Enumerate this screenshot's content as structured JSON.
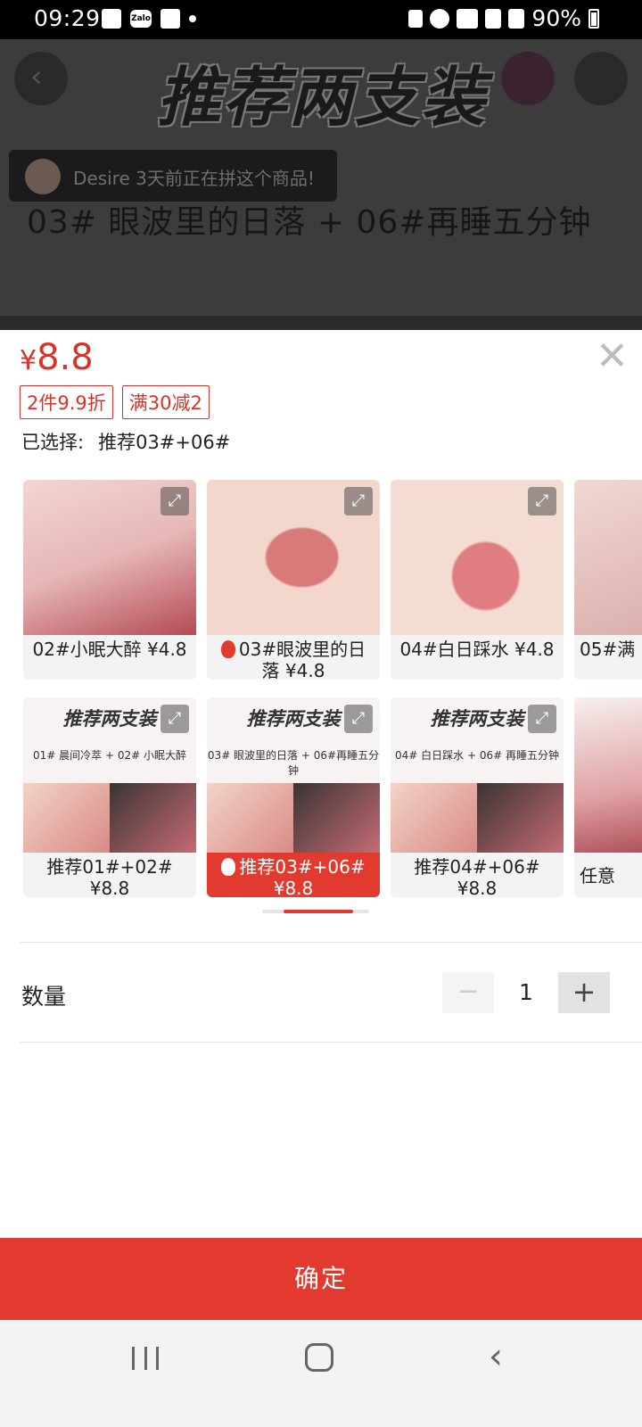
{
  "status_bar": {
    "time": "09:29",
    "battery": "90%"
  },
  "background_page": {
    "headline": "推荐两支装",
    "notice": "Desire 3天前正在拼这个商品!",
    "subtitle": "03# 眼波里的日落 + 06#再睡五分钟"
  },
  "sheet": {
    "price_symbol": "¥",
    "price_value": "8.8",
    "badges": [
      "2件9.9折",
      "满30减2"
    ],
    "selected_label": "已选择:",
    "selected_value": "推荐03#+06#",
    "options_row1": [
      {
        "label": "02#小眠大醉 ¥4.8",
        "hot": false,
        "selected": false
      },
      {
        "label": "03#眼波里的日落 ¥4.8",
        "hot": true,
        "selected": false
      },
      {
        "label": "04#白日踩水 ¥4.8",
        "hot": false,
        "selected": false
      },
      {
        "label": "05#满",
        "hot": false,
        "selected": false
      }
    ],
    "options_row2": [
      {
        "label": "推荐01#+02# ¥8.8",
        "hot": false,
        "selected": false,
        "combo_title": "推荐两支装",
        "combo_sub": "01# 晨间冷萃 + 02# 小眠大醉"
      },
      {
        "label": "推荐03#+06# ¥8.8",
        "hot": true,
        "selected": true,
        "combo_title": "推荐两支装",
        "combo_sub": "03# 眼波里的日落 + 06#再睡五分钟"
      },
      {
        "label": "推荐04#+06# ¥8.8",
        "hot": false,
        "selected": false,
        "combo_title": "推荐两支装",
        "combo_sub": "04# 白日踩水 + 06# 再睡五分钟"
      },
      {
        "label": "任意",
        "hot": false,
        "selected": false
      }
    ],
    "quantity_label": "数量",
    "quantity_value": "1",
    "minus": "−",
    "plus": "+",
    "confirm_label": "确定",
    "close_glyph": "✕"
  },
  "colors": {
    "accent": "#e23a2e",
    "price": "#d8322a"
  }
}
